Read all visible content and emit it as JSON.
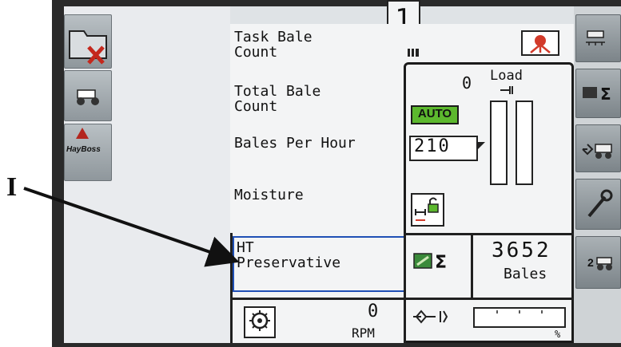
{
  "screen_number": "1",
  "annotation": {
    "label": "I"
  },
  "fields": [
    {
      "label": "Task Bale\nCount"
    },
    {
      "label": "Total Bale\nCount"
    },
    {
      "label": "Bales Per Hour"
    },
    {
      "label": "Moisture"
    },
    {
      "label": "HT\nPreservative",
      "selected": true
    }
  ],
  "load": {
    "value": "0",
    "label": "Load"
  },
  "auto_badge": "AUTO",
  "setpoint": "210",
  "bale_total": {
    "value": "3652",
    "unit": "Bales"
  },
  "rpm": {
    "value": "0",
    "unit": "RPM"
  },
  "percent_symbol": "%",
  "left_buttons": [
    {
      "icon": "folder-delete-icon"
    },
    {
      "icon": "tractor-icon"
    },
    {
      "icon": "haybuster-logo",
      "text": "HayBoss"
    }
  ],
  "right_buttons": [
    {
      "icon": "sprayer-icon"
    },
    {
      "icon": "bale-sum-icon",
      "text": "Σ"
    },
    {
      "icon": "drive-icon"
    },
    {
      "icon": "wrench-icon"
    },
    {
      "icon": "tractor-2-icon",
      "text": "2"
    }
  ],
  "colors": {
    "auto_green": "#5cb82e",
    "selection_blue": "#1f4fb5",
    "alarm_red": "#d23a2a"
  }
}
